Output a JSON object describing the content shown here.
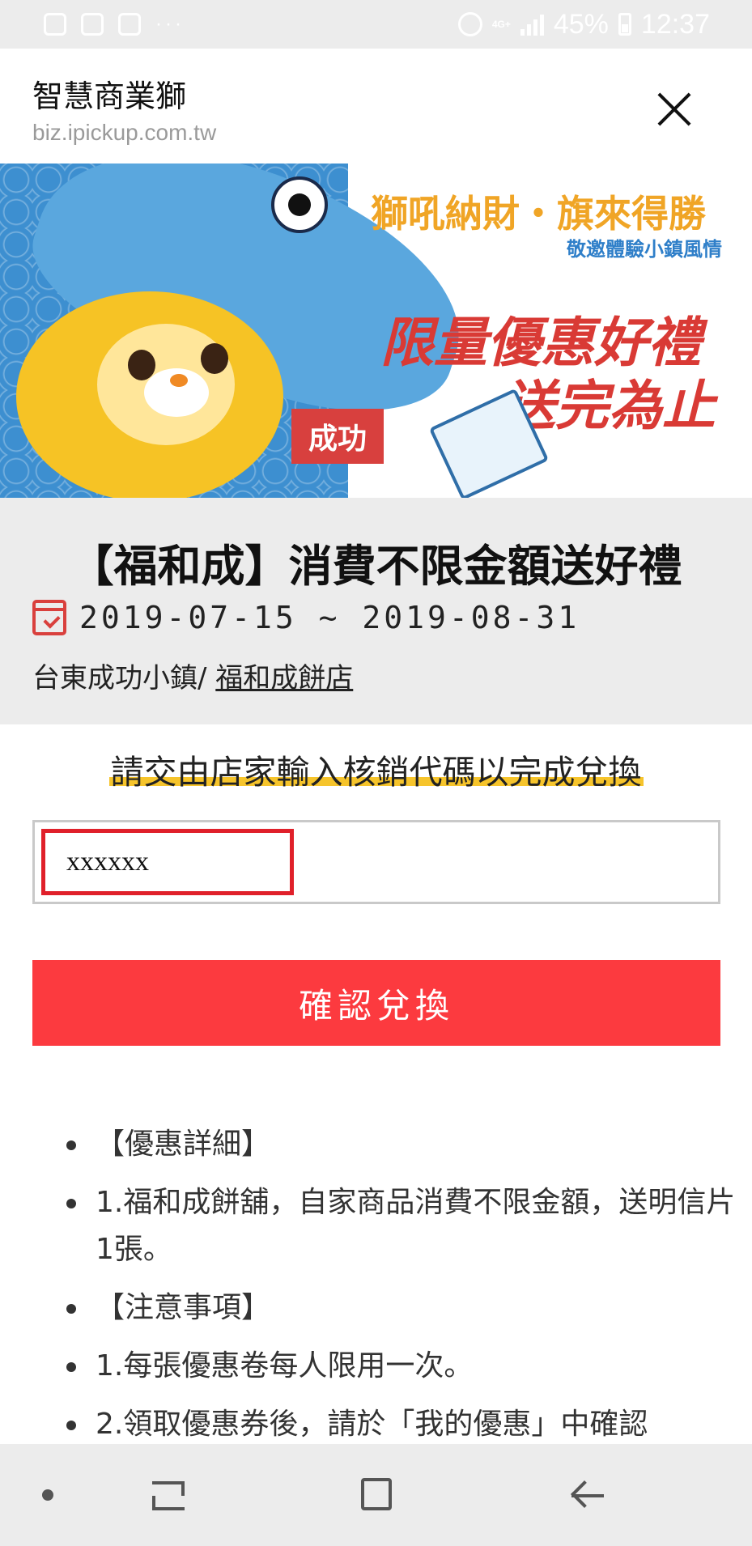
{
  "status_bar": {
    "dots": "···",
    "network": "4G+",
    "battery": "45%",
    "time": "12:37"
  },
  "header": {
    "site_name": "智慧商業獅",
    "site_url": "biz.ipickup.com.tw"
  },
  "banner": {
    "tagline": "獅吼納財・旗來得勝",
    "subtagline": "敬邀體驗小鎮風情",
    "promo_line1": "限量優惠好禮",
    "promo_line2": "送完為止",
    "badge": "成功"
  },
  "offer": {
    "title": "【福和成】消費不限金額送好禮",
    "date_range": "2019-07-15 ~ 2019-08-31",
    "location_prefix": "台東成功小鎮/ ",
    "store_name": "福和成餅店"
  },
  "redeem": {
    "instruction": "請交由店家輸入核銷代碼以完成兌換",
    "code_value": "xxxxxx",
    "confirm_label": "確認兌換"
  },
  "details": [
    "【優惠詳細】",
    "1.福和成餅舖，自家商品消費不限金額，送明信片1張。",
    "【注意事項】",
    "1.每張優惠卷每人限用一次。",
    "2.領取優惠券後，請於「我的優惠」中確認"
  ]
}
